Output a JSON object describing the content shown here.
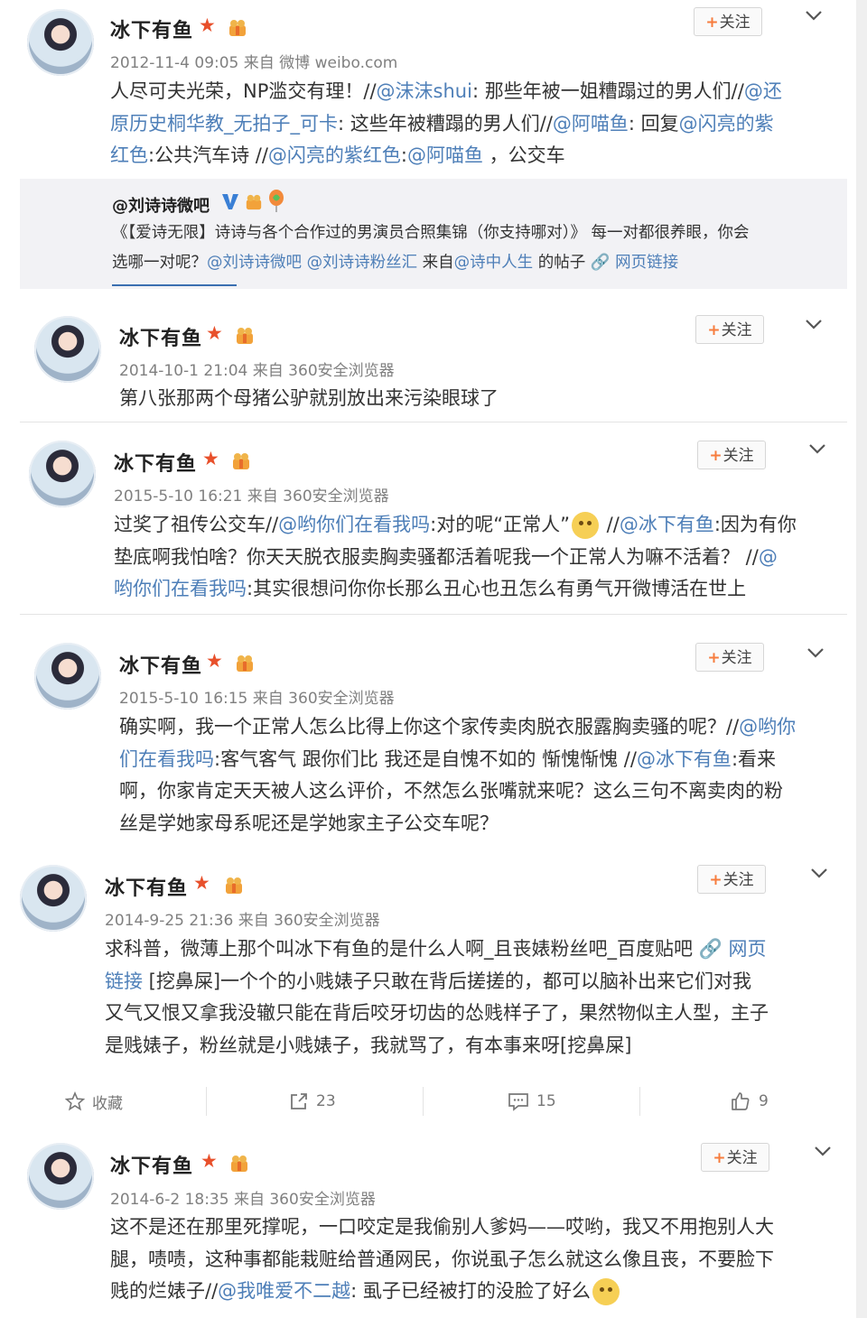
{
  "colors": {
    "link": "#4e7fb8",
    "star": "#e8502b",
    "accent": "#f77c3d",
    "retweet_bg": "#f2f2f5"
  },
  "common": {
    "follow_label": "关注",
    "follow_plus": "+"
  },
  "posts": [
    {
      "author": "冰下有鱼",
      "meta": "2012-11-4 09:05 来自 微博 weibo.com",
      "lines": [
        [
          {
            "t": "人尽可夫光荣，NP滥交有理！//"
          },
          {
            "t": "@沫沫shui",
            "link": true
          },
          {
            "t": ": 那些年被一姐糟蹋过的男人们//"
          },
          {
            "t": "@还",
            "link": true
          }
        ],
        [
          {
            "t": "原历史桐华教_无拍子_可卡",
            "link": true
          },
          {
            "t": ": 这些年被糟蹋的男人们//"
          },
          {
            "t": "@阿喵鱼",
            "link": true
          },
          {
            "t": ": 回复"
          },
          {
            "t": "@闪亮的紫",
            "link": true
          }
        ],
        [
          {
            "t": "红色",
            "link": true
          },
          {
            "t": ":公共汽车诗 //"
          },
          {
            "t": "@闪亮的紫红色",
            "link": true
          },
          {
            "t": ":"
          },
          {
            "t": "@阿喵鱼",
            "link": true
          },
          {
            "t": " ，公交车"
          }
        ]
      ],
      "retweet": {
        "name": "@刘诗诗微吧",
        "lines": [
          [
            {
              "t": "《【爱诗无限】诗诗与各个合作过的男演员合照集锦（你支持哪对）》 每一对都很养眼，你会"
            }
          ],
          [
            {
              "t": "选哪一对呢？"
            },
            {
              "t": "@刘诗诗微吧",
              "link": true
            },
            {
              "t": "  "
            },
            {
              "t": "@刘诗诗粉丝汇",
              "link": true
            },
            {
              "t": " 来自"
            },
            {
              "t": "@诗中人生",
              "link": true
            },
            {
              "t": " 的帖子  "
            },
            {
              "t": "🔗 网页链接",
              "link": true
            }
          ]
        ]
      }
    },
    {
      "author": "冰下有鱼",
      "meta": "2014-10-1 21:04 来自 360安全浏览器",
      "lines": [
        [
          {
            "t": "第八张那两个母猪公驴就别放出来污染眼球了"
          }
        ]
      ]
    },
    {
      "author": "冰下有鱼",
      "meta": "2015-5-10 16:21 来自 360安全浏览器",
      "lines": [
        [
          {
            "t": "过奖了祖传公交车//"
          },
          {
            "t": "@哟你们在看我吗",
            "link": true
          },
          {
            "t": ":对的呢“正常人”"
          },
          {
            "emoji": "doge"
          },
          {
            "t": " //"
          },
          {
            "t": "@冰下有鱼",
            "link": true
          },
          {
            "t": ":因为有你"
          }
        ],
        [
          {
            "t": "垫底啊我怕啥？你天天脱衣服卖胸卖骚都活着呢我一个正常人为嘛不活着？ //"
          },
          {
            "t": "@",
            "link": true
          }
        ],
        [
          {
            "t": "哟你们在看我吗",
            "link": true
          },
          {
            "t": ":其实很想问你你长那么丑心也丑怎么有勇气开微博活在世上"
          }
        ]
      ]
    },
    {
      "author": "冰下有鱼",
      "meta": "2015-5-10 16:15 来自 360安全浏览器",
      "lines": [
        [
          {
            "t": "确实啊，我一个正常人怎么比得上你这个家传卖肉脱衣服露胸卖骚的呢？//"
          },
          {
            "t": "@哟你",
            "link": true
          }
        ],
        [
          {
            "t": "们在看我吗",
            "link": true
          },
          {
            "t": ":客气客气 跟你们比 我还是自愧不如的 惭愧惭愧 //"
          },
          {
            "t": "@冰下有鱼",
            "link": true
          },
          {
            "t": ":看来"
          }
        ],
        [
          {
            "t": "啊，你家肯定天天被人这么评价，不然怎么张嘴就来呢？这么三句不离卖肉的粉"
          }
        ],
        [
          {
            "t": "丝是学她家母系呢还是学她家主子公交车呢？"
          }
        ]
      ]
    },
    {
      "author": "冰下有鱼",
      "meta": "2014-9-25 21:36 来自 360安全浏览器",
      "lines": [
        [
          {
            "t": "求科普，微薄上那个叫冰下有鱼的是什么人啊_且丧婊粉丝吧_百度贴吧  "
          },
          {
            "t": "🔗 网页",
            "link": true
          }
        ],
        [
          {
            "t": "链接",
            "link": true
          },
          {
            "t": " [挖鼻屎]一个个的小贱婊子只敢在背后搓搓的，都可以脑补出来它们对我"
          }
        ],
        [
          {
            "t": "又气又恨又拿我没辙只能在背后咬牙切齿的怂贱样子了，果然物似主人型，主子"
          }
        ],
        [
          {
            "t": "是贱婊子，粉丝就是小贱婊子，我就骂了，有本事来呀[挖鼻屎]"
          }
        ]
      ]
    },
    {
      "author": "冰下有鱼",
      "meta": "2014-6-2 18:35 来自 360安全浏览器",
      "lines": [
        [
          {
            "t": "这不是还在那里死撑呢，一口咬定是我偷别人爹妈——哎哟，我又不用抱别人大"
          }
        ],
        [
          {
            "t": "腿，啧啧，这种事都能栽赃给普通网民，你说虱子怎么就这么像且丧，不要脸下"
          }
        ],
        [
          {
            "t": "贱的烂婊子//"
          },
          {
            "t": "@我唯爱不二越",
            "link": true
          },
          {
            "t": ": 虱子已经被打的没脸了好么"
          },
          {
            "emoji": "smile"
          }
        ]
      ]
    }
  ],
  "actions": {
    "collect_label": "收藏",
    "repost_count": "23",
    "comment_count": "15",
    "like_count": "9"
  }
}
